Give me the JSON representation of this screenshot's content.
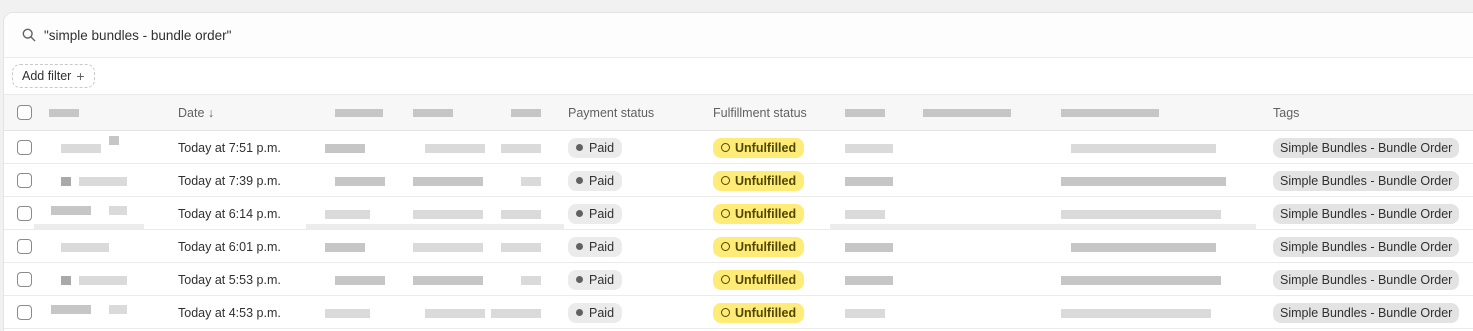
{
  "search": {
    "query": "\"simple bundles - bundle order\"",
    "icon": "search-icon"
  },
  "filter": {
    "add_filter_label": "Add filter",
    "plus_glyph": "+"
  },
  "table": {
    "headers": {
      "date": "Date ↓",
      "payment_status": "Payment status",
      "fulfillment_status": "Fulfillment status",
      "tags": "Tags"
    },
    "rows": [
      {
        "date": "Today at 7:51 p.m.",
        "payment": "Paid",
        "fulfillment": "Unfulfilled",
        "tag": "Simple Bundles - Bundle Order"
      },
      {
        "date": "Today at 7:39 p.m.",
        "payment": "Paid",
        "fulfillment": "Unfulfilled",
        "tag": "Simple Bundles - Bundle Order"
      },
      {
        "date": "Today at 6:14 p.m.",
        "payment": "Paid",
        "fulfillment": "Unfulfilled",
        "tag": "Simple Bundles - Bundle Order"
      },
      {
        "date": "Today at 6:01 p.m.",
        "payment": "Paid",
        "fulfillment": "Unfulfilled",
        "tag": "Simple Bundles - Bundle Order"
      },
      {
        "date": "Today at 5:53 p.m.",
        "payment": "Paid",
        "fulfillment": "Unfulfilled",
        "tag": "Simple Bundles - Bundle Order"
      },
      {
        "date": "Today at 4:53 p.m.",
        "payment": "Paid",
        "fulfillment": "Unfulfilled",
        "tag": "Simple Bundles - Bundle Order"
      }
    ]
  },
  "colors": {
    "unfulfilled_badge": "#ffeb78",
    "paid_badge": "#ebebeb",
    "tag_badge": "#e3e3e3"
  }
}
